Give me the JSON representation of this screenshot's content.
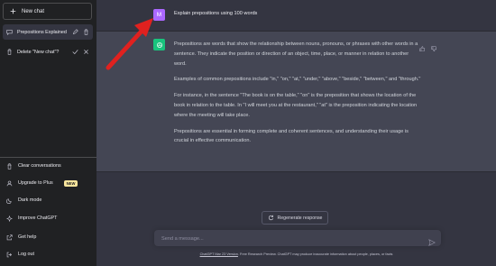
{
  "sidebar": {
    "new_chat": "New chat",
    "chats": [
      {
        "label": "Prepositions Explained"
      },
      {
        "label": "Delete \"New chat\"?"
      }
    ],
    "bottom": [
      {
        "label": "Clear conversations",
        "icon": "trash-icon"
      },
      {
        "label": "Upgrade to Plus",
        "icon": "user-icon",
        "badge": "NEW"
      },
      {
        "label": "Dark mode",
        "icon": "moon-icon"
      },
      {
        "label": "Improve ChatGPT",
        "icon": "sparkle-icon"
      },
      {
        "label": "Get help",
        "icon": "external-link-icon"
      },
      {
        "label": "Log out",
        "icon": "logout-icon"
      }
    ]
  },
  "conversation": {
    "user_initial": "M",
    "user_message": "Explain prepositions using 100 words",
    "assistant_paragraphs": [
      "Prepositions are words that show the relationship between nouns, pronouns, or phrases with other words in a sentence. They indicate the position or direction of an object, time, place, or manner in relation to another word.",
      "Examples of common prepositions include \"in,\" \"on,\" \"at,\" \"under,\" \"above,\" \"beside,\" \"between,\" and \"through.\"",
      "For instance, in the sentence \"The book is on the table,\" \"on\" is the preposition that shows the location of the book in relation to the table. In \"I will meet you at the restaurant,\" \"at\" is the preposition indicating the location where the meeting will take place.",
      "Prepositions are essential in forming complete and coherent sentences, and understanding their usage is crucial in effective communication."
    ]
  },
  "composer": {
    "regenerate_label": "Regenerate response",
    "placeholder": "Send a message...",
    "footer_link": "ChatGPT Mar 23 Version",
    "footer_text": ". Free Research Preview. ChatGPT may produce inaccurate information about people, places, or facts"
  },
  "colors": {
    "sidebar_bg": "#202123",
    "main_bg": "#343541",
    "assistant_bg": "#444654",
    "user_avatar": "#ab68ff",
    "gpt_avatar": "#19c37d",
    "annotation_arrow": "#e0211f",
    "badge": "#fae69e"
  }
}
